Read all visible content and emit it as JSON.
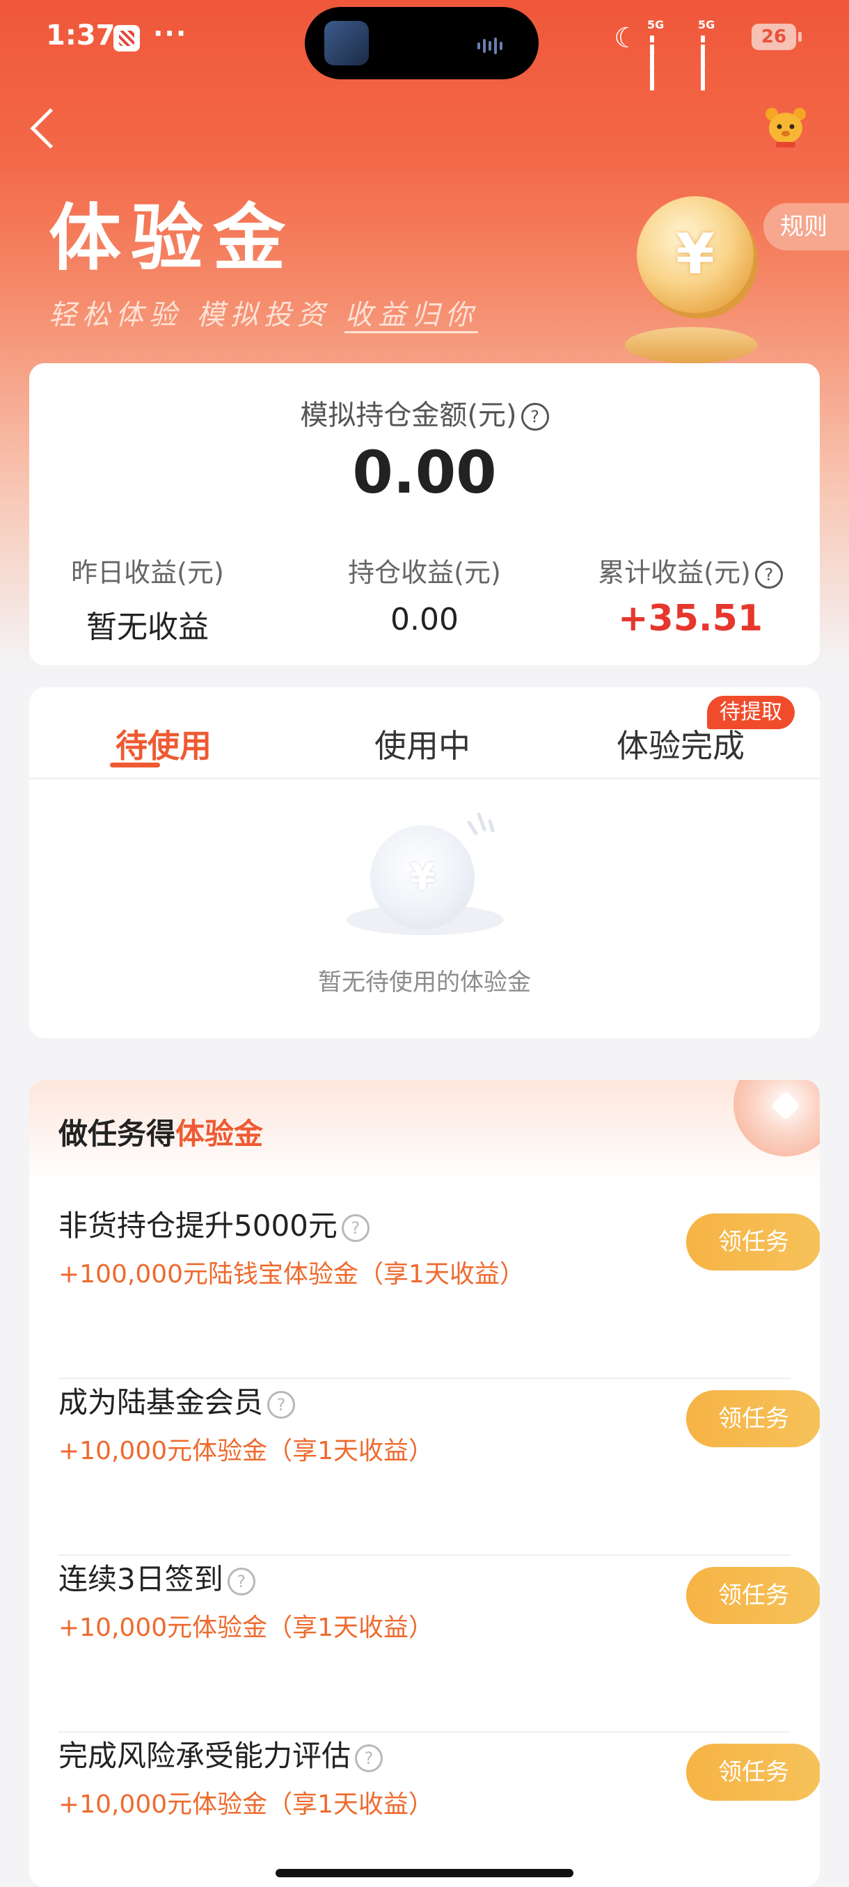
{
  "status_bar": {
    "time": "1:37",
    "dots": "···",
    "signal1_label": "5G",
    "signal2_label": "5G",
    "battery": "26"
  },
  "nav": {
    "back_icon": "chevron-left-icon",
    "mascot_icon": "mascot-icon"
  },
  "hero": {
    "title": "体验金",
    "subtitle_part1": "轻松体验 模拟投资 ",
    "subtitle_part2": "收益归你",
    "rules_label": "规则",
    "coin_symbol": "¥"
  },
  "summary": {
    "holding_label": "模拟持仓金额(元)",
    "holding_value": "0.00",
    "yesterday_label": "昨日收益(元)",
    "yesterday_value": "暂无收益",
    "position_label": "持仓收益(元)",
    "position_value": "0.00",
    "total_label": "累计收益(元)",
    "total_value": "+35.51",
    "help_glyph": "?"
  },
  "tabs": {
    "items": [
      "待使用",
      "使用中",
      "体验完成"
    ],
    "badge": "待提取",
    "active_index": 0,
    "empty_text": "暂无待使用的体验金",
    "empty_coin_symbol": "¥"
  },
  "tasks": {
    "title_prefix": "做任务得",
    "title_highlight": "体验金",
    "items": [
      {
        "title": "非货持仓提升5000元",
        "reward": "+100,000元陆钱宝体验金（享1天收益）",
        "button": "领任务"
      },
      {
        "title": "成为陆基金会员",
        "reward": "+10,000元体验金（享1天收益）",
        "button": "领任务"
      },
      {
        "title": "连续3日签到",
        "reward": "+10,000元体验金（享1天收益）",
        "button": "领任务"
      },
      {
        "title": "完成风险承受能力评估",
        "reward": "+10,000元体验金（享1天收益）",
        "button": "领任务"
      }
    ]
  },
  "colors": {
    "brand": "#f0573a",
    "accent": "#ee5a33",
    "profit_red": "#e6372d",
    "task_button": "#f7b345"
  }
}
